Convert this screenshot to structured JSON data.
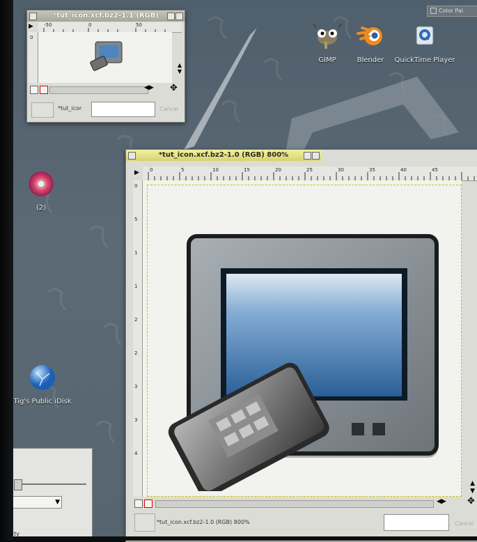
{
  "small_window": {
    "title": "*tut_icon.xcf.bz2-1.1 (RGB)",
    "ruler_labels": [
      "-50",
      "0",
      "50"
    ],
    "status_text": "*tut_icor",
    "cancel_label": "Cancel"
  },
  "large_window": {
    "title": "*tut_icon.xcf.bz2-1.0 (RGB) 800%",
    "ruler_labels": [
      "0",
      "5",
      "10",
      "15",
      "20",
      "25",
      "30",
      "35",
      "40",
      "45"
    ],
    "vruler_labels": [
      "0",
      "5",
      "1",
      "1",
      "2",
      "2",
      "3",
      "3",
      "4"
    ],
    "status_text": "*tut_icon.xcf.bz2-1.0 (RGB) 800%",
    "cancel_label": "Cancel"
  },
  "color_panel_title": "Color Pal",
  "desktop_icons": [
    {
      "name": "gimp",
      "label": "GIMP"
    },
    {
      "name": "blender",
      "label": "Blender"
    },
    {
      "name": "quicktime",
      "label": "QuickTime Player"
    },
    {
      "name": "cd",
      "label": "(2)"
    },
    {
      "name": "idisk",
      "label": "Tig's Public iDisk"
    }
  ],
  "bottom_panel": {
    "label": "ty"
  },
  "colors": {
    "desktop": "#56656f",
    "active_title": "#e9e88a",
    "window_bg": "#dcdcd7"
  }
}
